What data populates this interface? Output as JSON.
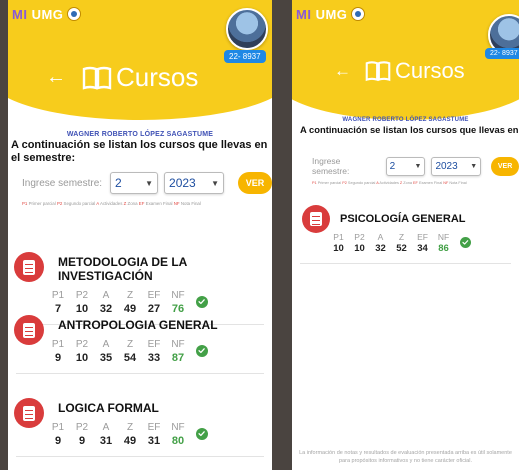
{
  "app": {
    "brand_prefix": "MI",
    "brand_name": "UMG",
    "student_id": "22- 8937",
    "page_title": "Cursos",
    "back_icon": "arrow-left-icon",
    "title_icon": "book-icon"
  },
  "left": {
    "student_name": "WAGNER ROBERTO LÓPEZ SAGASTUME",
    "intro": "A continuación se listan los cursos que llevas en el semestre:",
    "semester_label": "Ingrese semestre:",
    "semester_value": "2",
    "year_value": "2023",
    "ver_label": "VER",
    "legend": [
      {
        "k": "P1",
        "v": "Primer parcial"
      },
      {
        "k": "P2",
        "v": "Segundo parcial"
      },
      {
        "k": "A",
        "v": "Actividades"
      },
      {
        "k": "Z",
        "v": "Zona"
      },
      {
        "k": "EF",
        "v": "Examen Final"
      },
      {
        "k": "NF",
        "v": "Nota Final"
      }
    ],
    "grade_headers": [
      "P1",
      "P2",
      "A",
      "Z",
      "EF",
      "NF"
    ],
    "courses": [
      {
        "name": "METODOLOGIA DE LA INVESTIGACIÓN",
        "grades": [
          "7",
          "10",
          "32",
          "49",
          "27",
          "76"
        ]
      },
      {
        "name": "ANTROPOLOGIA GENERAL",
        "grades": [
          "9",
          "10",
          "35",
          "54",
          "33",
          "87"
        ]
      },
      {
        "name": "LOGICA FORMAL",
        "grades": [
          "9",
          "9",
          "31",
          "49",
          "31",
          "80"
        ]
      }
    ]
  },
  "right": {
    "student_name": "WAGNER ROBERTO LÓPEZ SAGASTUME",
    "intro": "A continuación se listan los cursos que llevas en el semestre:",
    "semester_label": "Ingrese semestre:",
    "semester_value": "2",
    "year_value": "2023",
    "ver_label": "VER",
    "legend": [
      {
        "k": "P1",
        "v": "Primer parcial"
      },
      {
        "k": "P2",
        "v": "Segundo parcial"
      },
      {
        "k": "A",
        "v": "Actividades"
      },
      {
        "k": "Z",
        "v": "Zona"
      },
      {
        "k": "EF",
        "v": "Examen Final"
      },
      {
        "k": "NF",
        "v": "Nota Final"
      }
    ],
    "grade_headers": [
      "P1",
      "P2",
      "A",
      "Z",
      "EF",
      "NF"
    ],
    "courses": [
      {
        "name": "PSICOLOGÍA GENERAL",
        "grades": [
          "10",
          "10",
          "32",
          "52",
          "34",
          "86"
        ]
      }
    ],
    "footer": "La información de notas y resultados de evaluación presentada arriba es útil solamente para propósitos informativos y no tiene carácter oficial."
  },
  "colors": {
    "header": "#f7cc1c",
    "accent_button": "#f7b500",
    "course_icon": "#d93c3c",
    "final_grade": "#43a047",
    "student_name": "#3f51b5",
    "badge": "#1e88e5"
  }
}
